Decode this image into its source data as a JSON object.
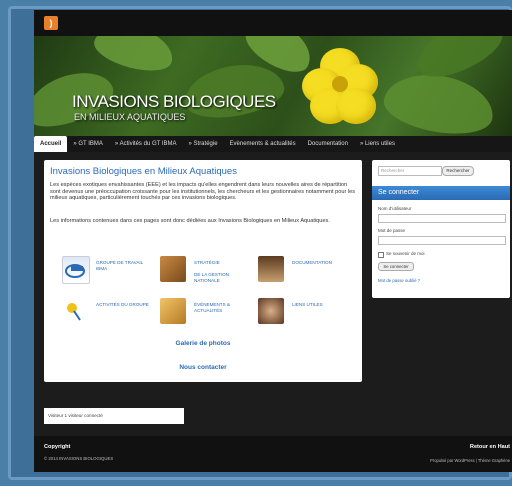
{
  "header": {
    "title": "INVASIONS BIOLOGIQUES",
    "subtitle": "EN MILIEUX AQUATIQUES",
    "rss_icon": "rss-icon"
  },
  "nav": {
    "items": [
      {
        "label": "Accueil",
        "active": true
      },
      {
        "label": "» GT IBMA",
        "active": false
      },
      {
        "label": "» Activités du GT IBMA",
        "active": false
      },
      {
        "label": "» Stratégie",
        "active": false
      },
      {
        "label": "Evènements & actualités",
        "active": false
      },
      {
        "label": "Documentation",
        "active": false
      },
      {
        "label": "» Liens utiles",
        "active": false
      }
    ]
  },
  "main": {
    "heading": "Invasions Biologiques en Milieux Aquatiques",
    "para1": "Les espèces exotiques envahissantes (EEE) et les impacts qu'elles engendrent dans leurs nouvelles aires de répartition sont devenus une préoccupation croissante pour les institutionnels, les chercheurs et les gestionnaires notamment pour les milieux aquatiques, particulièrement touchés par ces invasions biologiques.",
    "para2": "Les informations contenues dans ces pages sont donc dédiées aux Invasions Biologiques en Milieux Aquatiques.",
    "grid": [
      {
        "label": "GROUPE DE TRAVAIL IBMA"
      },
      {
        "label": "STRATÉGIE"
      },
      {
        "label": "DOCUMENTATION"
      },
      {
        "label": "ACTIVITÉS DU GROUPE"
      },
      {
        "label": "ÉVÈNEMENTS & ACTUALITÉS"
      },
      {
        "label": "LIENS UTILES"
      }
    ],
    "grid2_extra": "DE LA GESTION NATIONALE",
    "gallery_link": "Galerie de photos",
    "contact_link": "Nous contacter"
  },
  "sidebar": {
    "search_placeholder": "Rechercher",
    "search_button": "Rechercher",
    "login_title": "Se connecter",
    "username_label": "Nom d'utilisateur",
    "password_label": "Mot de passe",
    "remember_label": "Se souvenir de moi",
    "login_button": "Se connecter",
    "lost_password": "Mot de passe oublié ?"
  },
  "counter": {
    "text": "Visiteur 1 visiteur connecté"
  },
  "footer": {
    "copyright_title": "Copyright",
    "copyright_text": "© 2014 INVASIONS BIOLOGIQUES",
    "back_top": "Retour en Haut",
    "powered": "Propulsé par WordPress | Thème Graphène"
  },
  "colors": {
    "accent": "#2a6ab4",
    "background": "#4a7fa8",
    "dark": "#1c1c1c"
  }
}
